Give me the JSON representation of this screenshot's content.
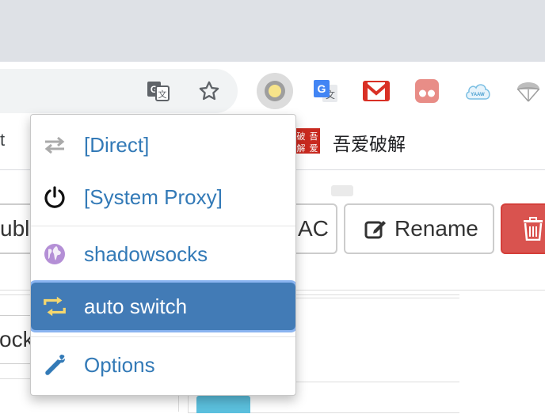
{
  "omnibox": {
    "translate_icon": "google-translate-icon",
    "bookmark_icon": "star-icon"
  },
  "extensions": [
    {
      "name": "proxy-switcher-icon",
      "active": true
    },
    {
      "name": "google-translate-icon"
    },
    {
      "name": "gmail-icon"
    },
    {
      "name": "vk-icon"
    },
    {
      "name": "yaaw-cloud-icon"
    },
    {
      "name": "parachute-icon"
    }
  ],
  "bookmarks_bar": {
    "left_text": "t",
    "item_label": "吾爱破解",
    "item_icon_text": "破吾解爱"
  },
  "page": {
    "left_button_text": "ublis",
    "ac_button_text": "AC",
    "rename_button": "Rename",
    "left_input_text": "ocks"
  },
  "menu": {
    "items": [
      {
        "label": "[Direct]",
        "icon": "switch-arrows-icon"
      },
      {
        "label": "[System Proxy]",
        "icon": "power-icon"
      },
      {
        "label": "shadowsocks",
        "icon": "globe-icon"
      },
      {
        "label": "auto switch",
        "icon": "retweet-icon",
        "selected": true
      },
      {
        "label": "Options",
        "icon": "wrench-icon"
      }
    ]
  },
  "colors": {
    "link": "#337ab7",
    "selected_bg": "#427bb6",
    "delete_button": "#d9534f"
  }
}
